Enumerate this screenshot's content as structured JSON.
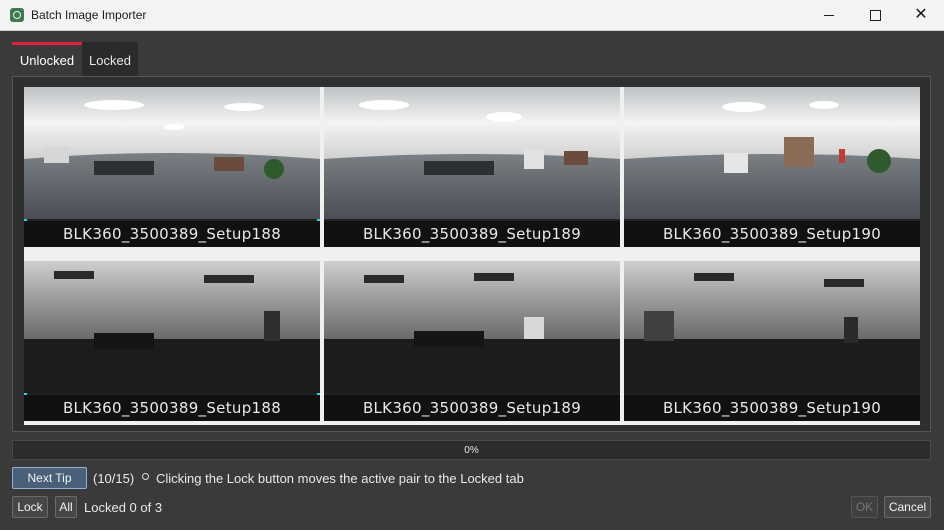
{
  "window": {
    "title": "Batch Image Importer"
  },
  "tabs": [
    {
      "label": "Unlocked",
      "active": true
    },
    {
      "label": "Locked",
      "active": false
    }
  ],
  "thumbnails": {
    "rows": [
      {
        "type": "color",
        "items": [
          {
            "caption": "BLK360_3500389_Setup188",
            "selected": true
          },
          {
            "caption": "BLK360_3500389_Setup189",
            "selected": false
          },
          {
            "caption": "BLK360_3500389_Setup190",
            "selected": false
          }
        ]
      },
      {
        "type": "grayscale",
        "items": [
          {
            "caption": "BLK360_3500389_Setup188",
            "selected": true
          },
          {
            "caption": "BLK360_3500389_Setup189",
            "selected": false
          },
          {
            "caption": "BLK360_3500389_Setup190",
            "selected": false
          }
        ]
      }
    ]
  },
  "progress": {
    "value": 0,
    "text": "0%"
  },
  "tip": {
    "button_label": "Next Tip",
    "counter": "(10/15)",
    "bullet": "°",
    "text": "Clicking the Lock button moves the active pair to the Locked tab"
  },
  "footer": {
    "lock_label": "Lock",
    "all_label": "All",
    "status": "Locked 0 of 3",
    "ok_label": "OK",
    "cancel_label": "Cancel"
  },
  "colors": {
    "selection": "#27d7e0",
    "active_tab_accent": "#e0203c"
  }
}
